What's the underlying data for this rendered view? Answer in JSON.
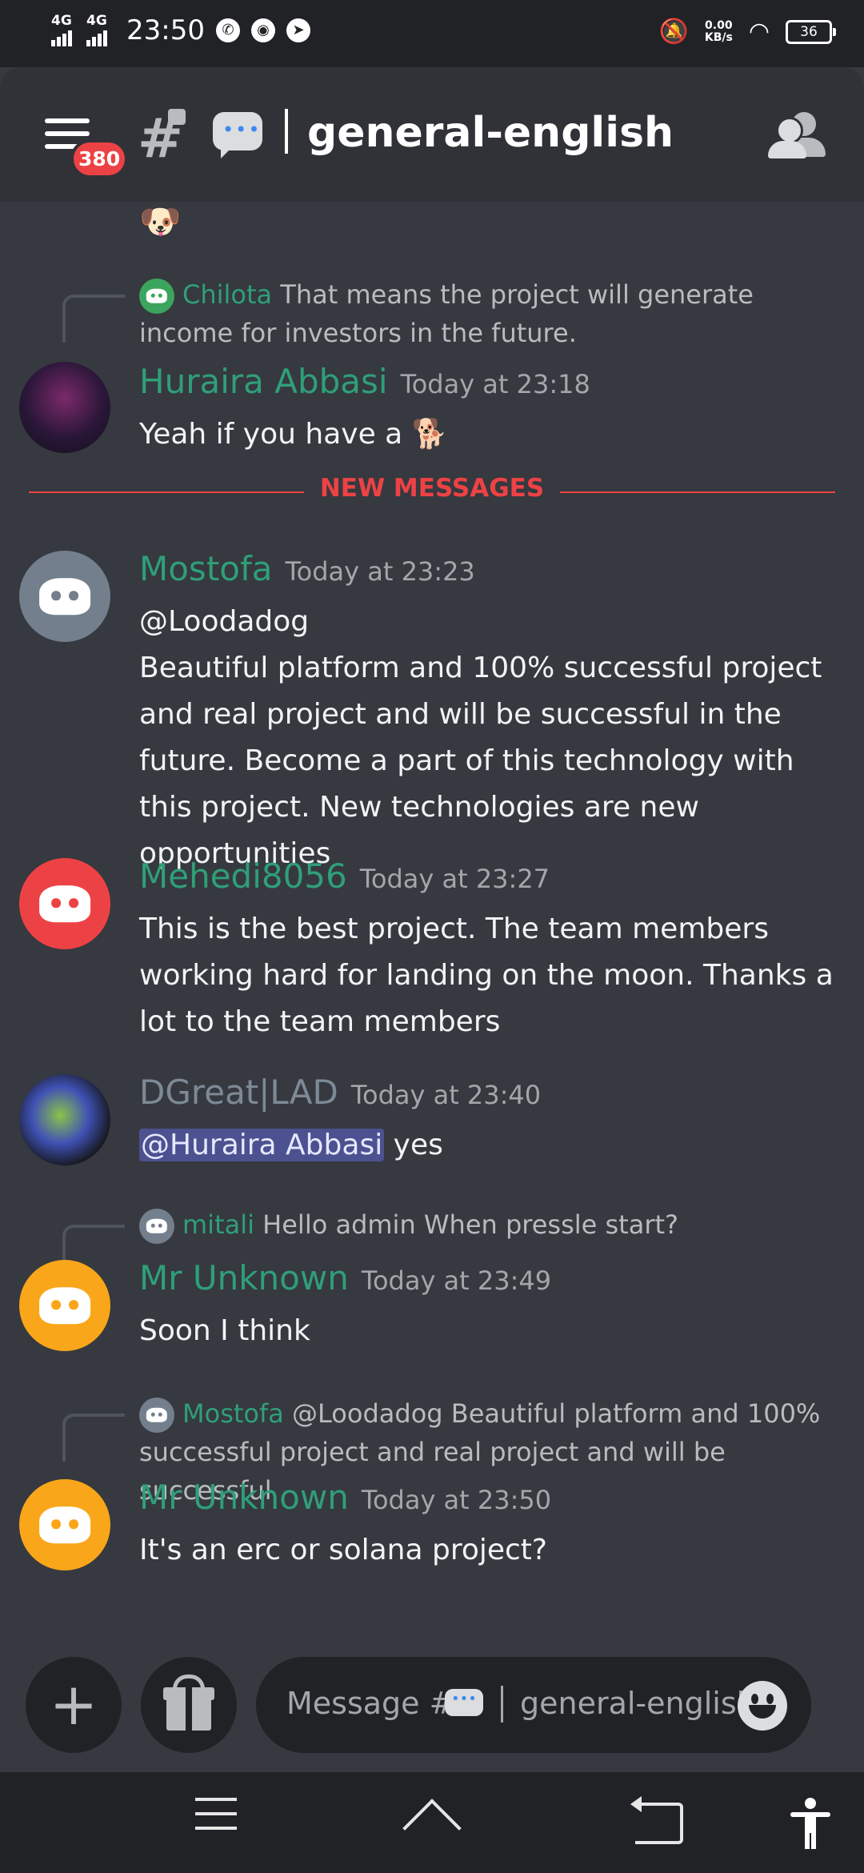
{
  "status_bar": {
    "net1": "4G",
    "net2": "4G",
    "time": "23:50",
    "speed_value": "0.00",
    "speed_unit": "KB/s",
    "battery": "36"
  },
  "header": {
    "badge": "380",
    "channel_name": "general-english"
  },
  "messages": {
    "reply1": {
      "name": "Chilota",
      "text": "That means the project will generate income for investors in the future."
    },
    "m1": {
      "author": "Huraira Abbasi",
      "time": "Today at 23:18",
      "text": "Yeah if you have a 🐕"
    },
    "divider": "NEW MESSAGES",
    "m2": {
      "author": "Mostofa",
      "time": "Today at 23:23",
      "mention": "@Loodadog",
      "text": "Beautiful platform and 100% successful project and real project and will be successful in the future. Become a part of this technology with this project. New technologies are new opportunities"
    },
    "m3": {
      "author": "Mehedi8056",
      "time": "Today at 23:27",
      "text": "This is the best project. The team members working hard for landing on the moon. Thanks a lot to the team members"
    },
    "m4": {
      "author": "DGreat|LAD",
      "time": "Today at 23:40",
      "mention": "@Huraira Abbasi",
      "text": " yes"
    },
    "reply2": {
      "name": "mitali",
      "text": "Hello admin When pressle start?"
    },
    "m5": {
      "author": "Mr Unknown",
      "time": "Today at 23:49",
      "text": "Soon I think"
    },
    "reply3": {
      "name": "Mostofa",
      "text": "@Loodadog Beautiful platform and 100% successful project and real project and will be successful"
    },
    "m6": {
      "author": "Mr Unknown",
      "time": "Today at 23:50",
      "text": "It's an erc or solana project?"
    }
  },
  "composer": {
    "placeholder_prefix": "Message #",
    "placeholder_channel": "general-english"
  }
}
